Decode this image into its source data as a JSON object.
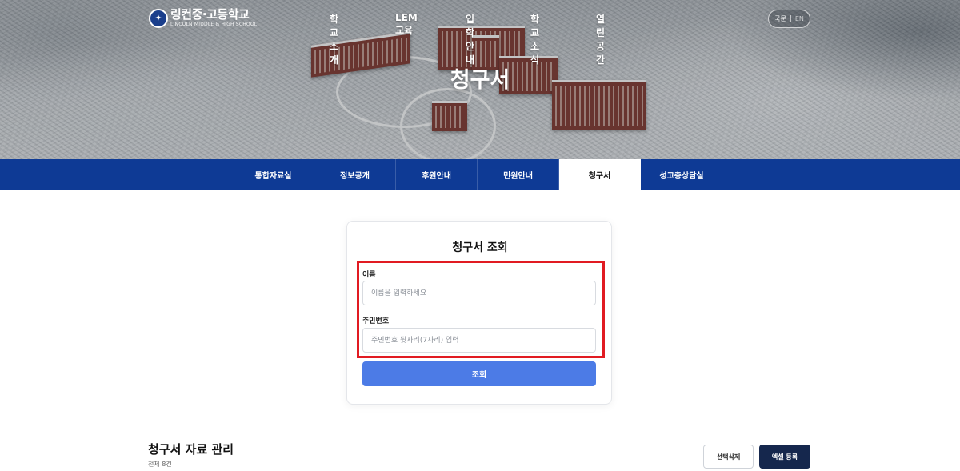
{
  "header": {
    "logo_name": "링컨중·고등학교",
    "logo_sub": "LINCOLN MIDDLE & HIGH SCHOOL",
    "nav": [
      "학교소개",
      "LEM 교육",
      "입학안내",
      "학교소식",
      "열린공간"
    ],
    "lang": {
      "ko": "국문",
      "en": "EN"
    }
  },
  "hero": {
    "title": "청구서"
  },
  "subnav": {
    "tabs": [
      "통합자료실",
      "정보공개",
      "후원안내",
      "민원안내",
      "청구서",
      "성고충상담실"
    ],
    "active": "청구서"
  },
  "lookup": {
    "title": "청구서 조회",
    "name_label": "이름",
    "name_placeholder": "이름을 입력하세요",
    "id_label": "주민번호",
    "id_placeholder": "주민번호 뒷자리(7자리) 입력",
    "submit_label": "조회"
  },
  "manage": {
    "title": "청구서 자료 관리",
    "count": "전체 8건",
    "delete_label": "선택삭제",
    "excel_label": "엑셀 등록"
  },
  "colors": {
    "navy_bar": "#0e3a95",
    "primary_button": "#4c7be6",
    "dark_button": "#15274d",
    "highlight": "#e11b22"
  }
}
